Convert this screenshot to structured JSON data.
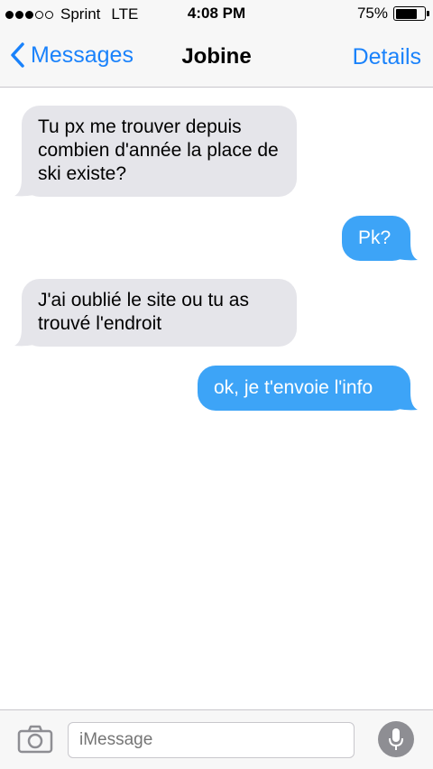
{
  "status_bar": {
    "carrier": "Sprint",
    "network": "LTE",
    "time": "4:08 PM",
    "battery_percent": "75%",
    "battery_level": 0.75,
    "signal_bars_filled": 3,
    "signal_bars_total": 5
  },
  "nav": {
    "back_label": "Messages",
    "title": "Jobine",
    "details_label": "Details"
  },
  "messages": [
    {
      "direction": "incoming",
      "text": "Tu px me trouver depuis combien d'année la place de ski existe?"
    },
    {
      "direction": "outgoing",
      "text": "Pk?"
    },
    {
      "direction": "incoming",
      "text": "J'ai oublié le site ou tu as trouvé l'endroit"
    },
    {
      "direction": "outgoing",
      "text": "ok, je t'envoie l'info"
    }
  ],
  "input": {
    "placeholder": "iMessage"
  },
  "colors": {
    "accent": "#1a82fb",
    "outgoing_bubble": "#3da4f7",
    "incoming_bubble": "#e5e5ea",
    "bar_background": "#f7f7f7",
    "mic_button": "#8e8e93"
  },
  "icons": [
    "chevron-left-icon",
    "camera-icon",
    "microphone-icon",
    "battery-icon",
    "signal-dots-icon"
  ]
}
